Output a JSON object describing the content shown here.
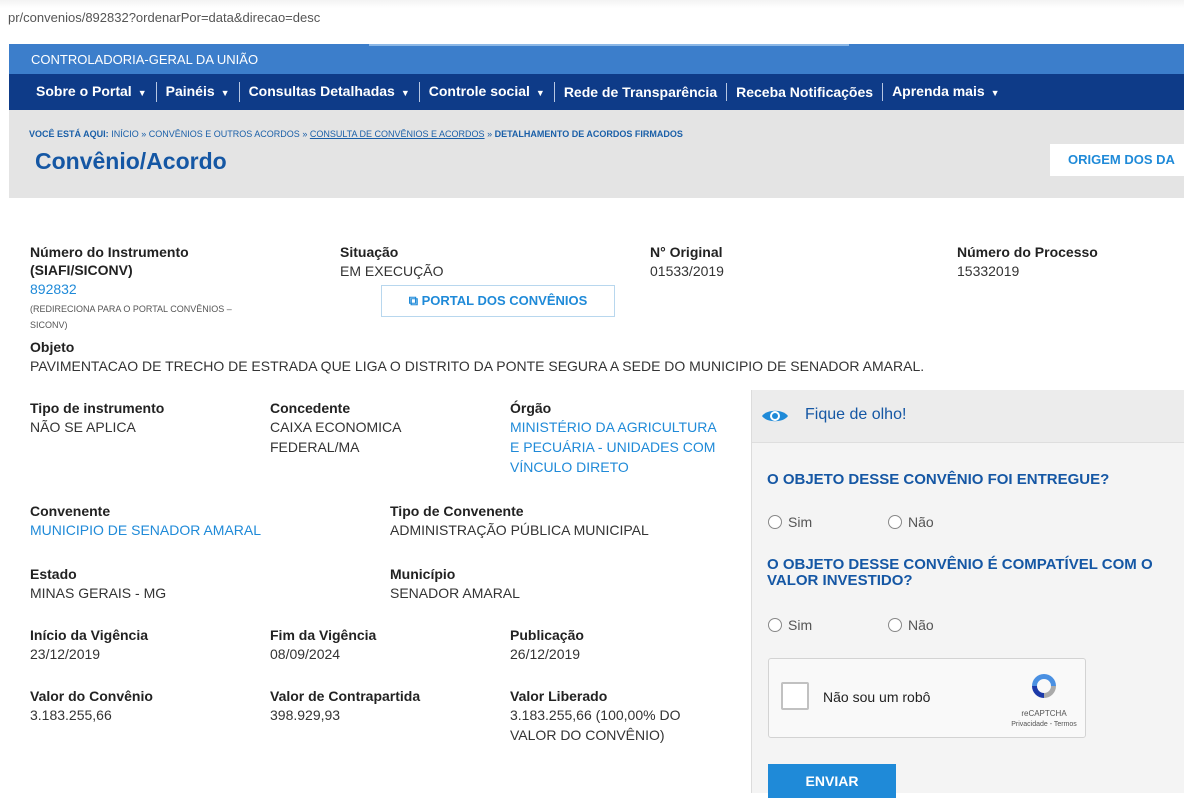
{
  "browser": {
    "url": "pr/convenios/892832?ordenarPor=data&direcao=desc"
  },
  "govbar": {
    "agency": "CONTROLADORIA-GERAL DA UNIÃO"
  },
  "nav": {
    "items": [
      {
        "label": "Sobre o Portal",
        "caret": "▼"
      },
      {
        "label": "Painéis",
        "caret": "▼"
      },
      {
        "label": "Consultas Detalhadas",
        "caret": "▼"
      },
      {
        "label": "Controle social",
        "caret": "▼"
      },
      {
        "label": "Rede de Transparência",
        "caret": ""
      },
      {
        "label": "Receba Notificações",
        "caret": ""
      },
      {
        "label": "Aprenda mais",
        "caret": "▼"
      }
    ]
  },
  "breadcrumb": {
    "prefix": "VOCÊ ESTÁ AQUI:",
    "c1": "INÍCIO",
    "sep": "»",
    "c2": "CONVÊNIOS E OUTROS ACORDOS",
    "c3": "CONSULTA DE CONVÊNIOS E ACORDOS",
    "c4": "DETALHAMENTO DE ACORDOS FIRMADOS"
  },
  "page": {
    "title": "Convênio/Acordo",
    "origin_button": "ORIGEM DOS DA"
  },
  "details": {
    "numero_label": "Número do Instrumento (SIAFI/SICONV)",
    "numero_value": "892832",
    "numero_note": "(REDIRECIONA PARA O PORTAL CONVÊNIOS – SICONV)",
    "situacao_label": "Situação",
    "situacao_value": "EM EXECUÇÃO",
    "portal_button": "PORTAL DOS CONVÊNIOS",
    "original_label": "N° Original",
    "original_value": "01533/2019",
    "processo_label": "Número do Processo",
    "processo_value": "15332019",
    "objeto_label": "Objeto",
    "objeto_value": "PAVIMENTACAO DE TRECHO DE ESTRADA QUE LIGA O DISTRITO DA PONTE SEGURA A SEDE DO MUNICIPIO DE SENADOR AMARAL.",
    "tipo_label": "Tipo de instrumento",
    "tipo_value": "NÃO SE APLICA",
    "concedente_label": "Concedente",
    "concedente_value_1": "CAIXA ECONOMICA",
    "concedente_value_2": "FEDERAL/MA",
    "orgao_label": "Órgão",
    "orgao_value_1": "MINISTÉRIO DA AGRICULTURA",
    "orgao_value_2": "E PECUÁRIA - UNIDADES COM",
    "orgao_value_3": "VÍNCULO DIRETO",
    "convenente_label": "Convenente",
    "convenente_value": "MUNICIPIO DE SENADOR AMARAL",
    "tipo_convenente_label": "Tipo de Convenente",
    "tipo_convenente_value": "ADMINISTRAÇÃO PÚBLICA MUNICIPAL",
    "estado_label": "Estado",
    "estado_value": "MINAS GERAIS - MG",
    "municipio_label": "Município",
    "municipio_value": "SENADOR AMARAL",
    "inicio_label": "Início da Vigência",
    "inicio_value": "23/12/2019",
    "fim_label": "Fim da Vigência",
    "fim_value": "08/09/2024",
    "publicacao_label": "Publicação",
    "publicacao_value": "26/12/2019",
    "valor_convenio_label": "Valor do Convênio",
    "valor_convenio_value": "3.183.255,66",
    "contrapartida_label": "Valor de Contrapartida",
    "contrapartida_value": "398.929,93",
    "liberado_label": "Valor Liberado",
    "liberado_value_1": "3.183.255,66 (100,00% DO",
    "liberado_value_2": "VALOR DO CONVÊNIO)"
  },
  "panel": {
    "title": "Fique de olho!",
    "q1": "O OBJETO DESSE CONVÊNIO FOI ENTREGUE?",
    "q2": "O OBJETO DESSE CONVÊNIO É COMPATÍVEL COM O VALOR INVESTIDO?",
    "yes": "Sim",
    "no": "Não",
    "captcha_label": "Não sou um robô",
    "captcha_brand": "reCAPTCHA",
    "captcha_terms": "Privacidade - Termos",
    "submit": "ENVIAR"
  }
}
